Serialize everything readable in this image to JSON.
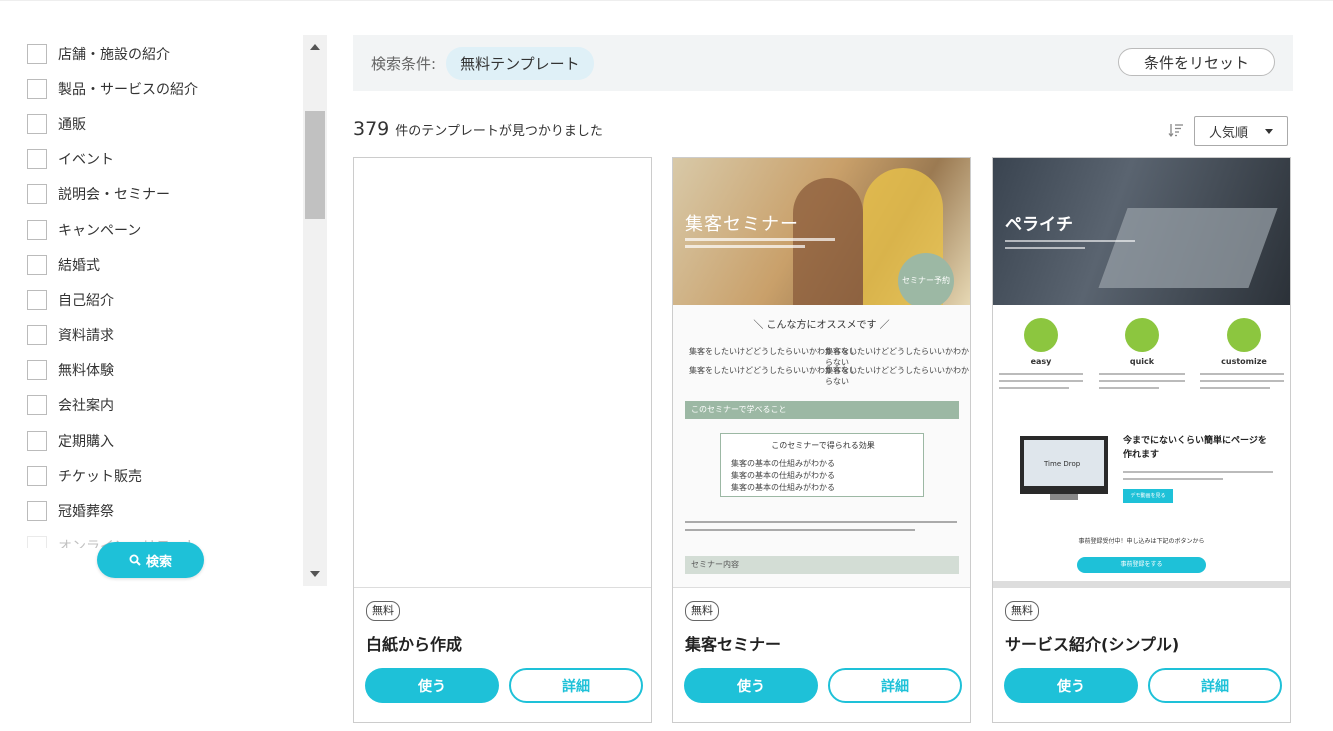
{
  "sidebar": {
    "categories": [
      "店舗・施設の紹介",
      "製品・サービスの紹介",
      "通販",
      "イベント",
      "説明会・セミナー",
      "キャンペーン",
      "結婚式",
      "自己紹介",
      "資料請求",
      "無料体験",
      "会社案内",
      "定期購入",
      "チケット販売",
      "冠婚葬祭",
      "オンライン・リモート"
    ],
    "search_label": "検索"
  },
  "filter": {
    "label": "検索条件:",
    "chip": "無料テンプレート",
    "reset_label": "条件をリセット"
  },
  "results": {
    "count": "379",
    "text": "件のテンプレートが見つかりました"
  },
  "sort": {
    "selected": "人気順"
  },
  "cards": [
    {
      "badge": "無料",
      "title": "白紙から作成",
      "use_label": "使う",
      "detail_label": "詳細"
    },
    {
      "badge": "無料",
      "title": "集客セミナー",
      "use_label": "使う",
      "detail_label": "詳細"
    },
    {
      "badge": "無料",
      "title": "サービス紹介(シンプル)",
      "use_label": "使う",
      "detail_label": "詳細"
    }
  ],
  "thumb_seminar": {
    "title": "集客セミナー",
    "circle": "セミナー予約",
    "heading": "＼ こんな方にオススメです ／",
    "check_text": "集客をしたいけどどうしたらいいかわからない",
    "band1": "このセミナーで学べること",
    "box_title": "このセミナーで得られる効果",
    "box_item": "集客の基本の仕組みがわかる",
    "band2": "セミナー内容"
  },
  "thumb_service": {
    "title": "ペライチ",
    "features": [
      "easy",
      "quick",
      "customize"
    ],
    "screen_text": "Time Drop",
    "headline": "今までにないくらい簡単にページを作れます",
    "cta1": "デモ動画を見る",
    "note": "事前登録受付中！申し込みは下記のボタンから",
    "cta2": "事前登録をする"
  },
  "colors": {
    "accent": "#1ec1d8",
    "seminar_green": "#9cb8a4",
    "feature_green": "#8cc63f"
  }
}
